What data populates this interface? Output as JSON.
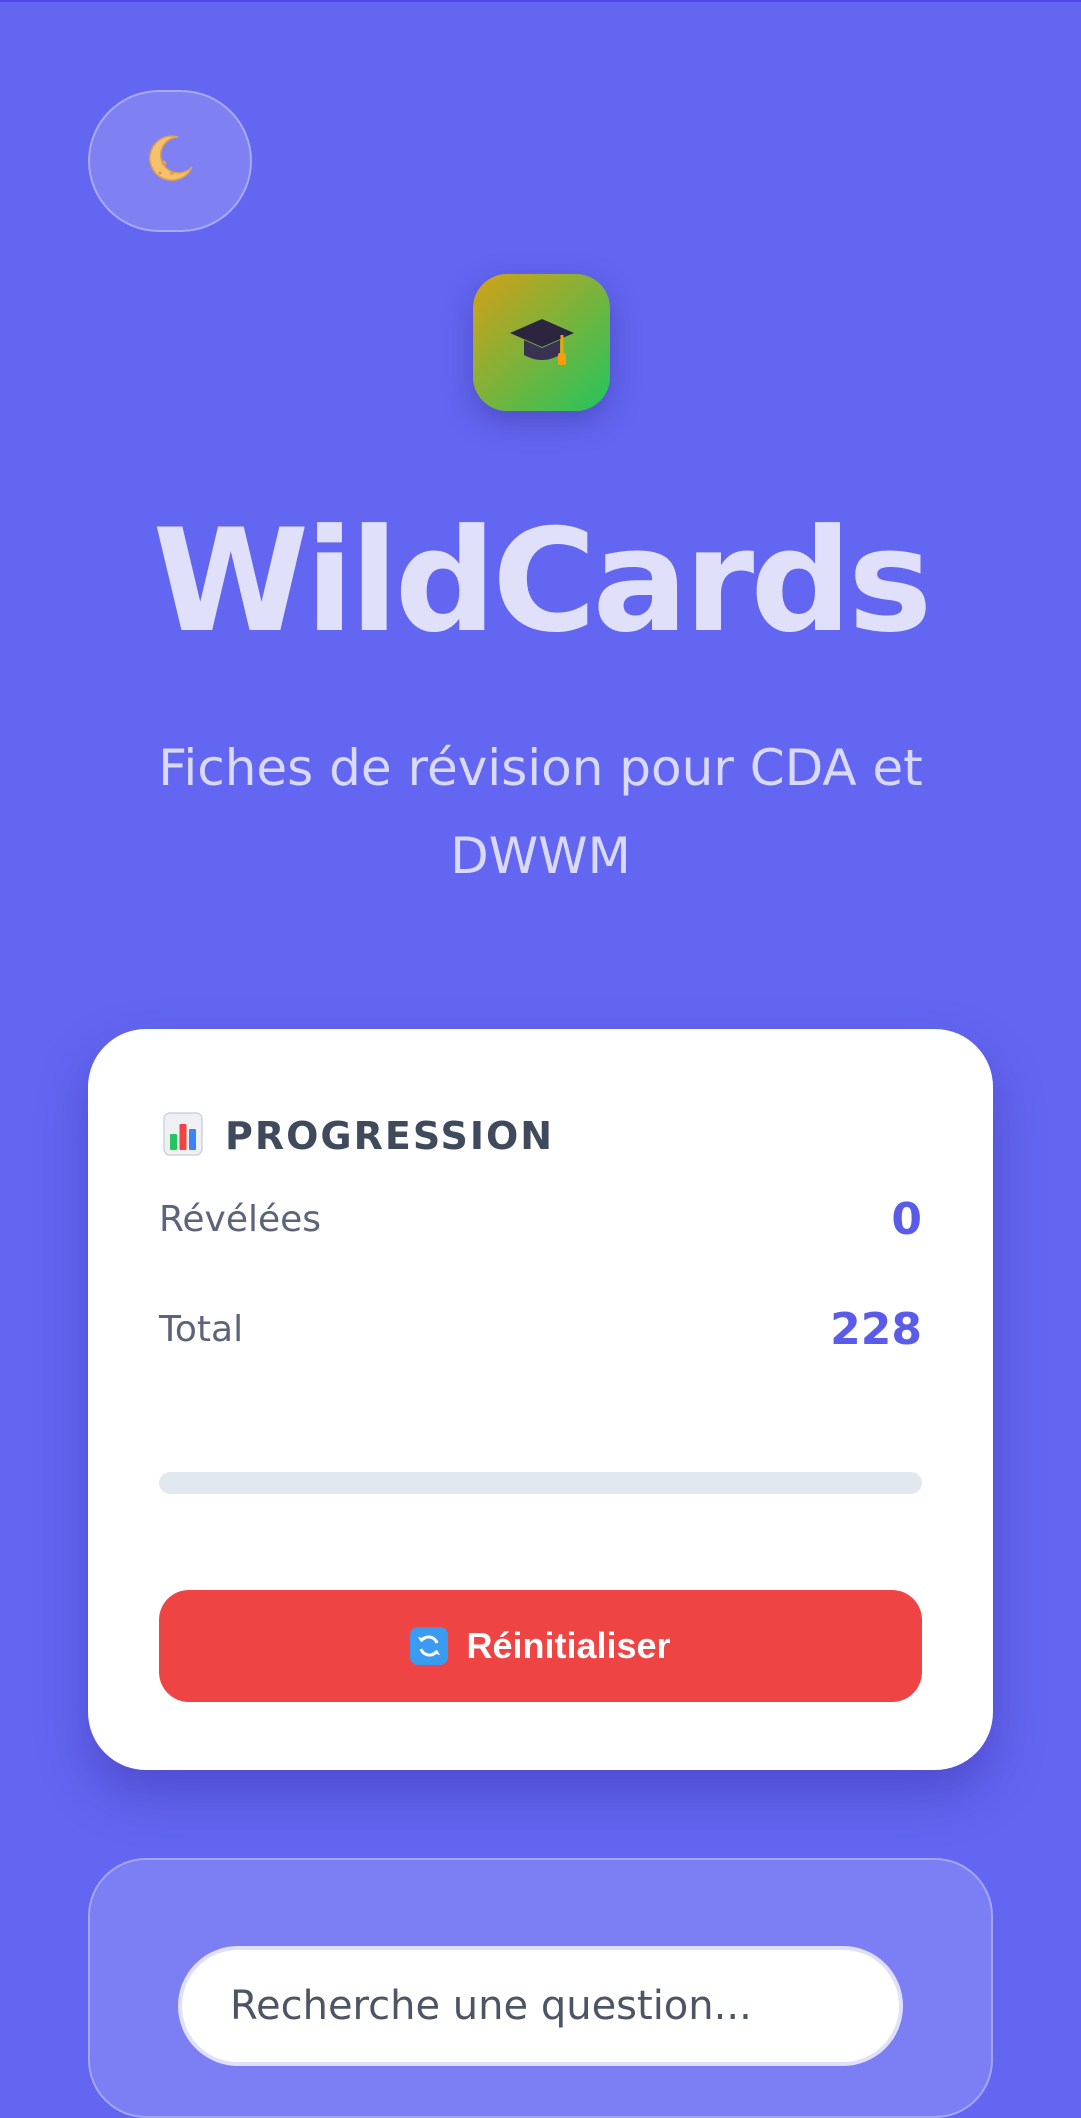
{
  "theme_toggle": {
    "icon": "crescent-moon-icon"
  },
  "logo": {
    "icon": "graduation-cap-icon"
  },
  "header": {
    "title": "WildCards",
    "subtitle": "Fiches de révision pour CDA et DWWM"
  },
  "progress_card": {
    "title_icon": "bar-chart-icon",
    "title": "PROGRESSION",
    "revealed_label": "Révélées",
    "revealed_value": "0",
    "total_label": "Total",
    "total_value": "228",
    "progress_fraction": 0,
    "reset_icon": "refresh-icon",
    "reset_label": "Réinitialiser"
  },
  "search": {
    "placeholder": "Recherche une question..."
  },
  "colors": {
    "background": "#6366f1",
    "accent": "#5b5bea",
    "danger": "#ef4444"
  }
}
